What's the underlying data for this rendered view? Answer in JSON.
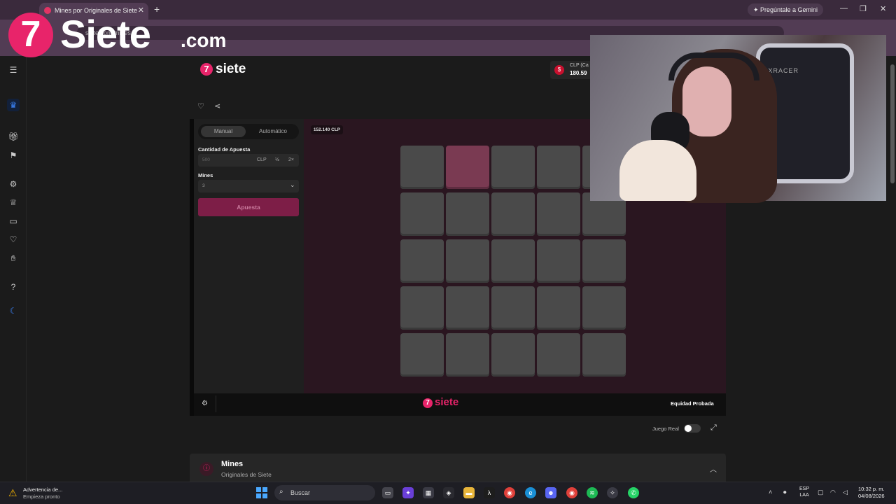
{
  "browser": {
    "tab_title": "Mines por Originales de Siete",
    "tab_close": "✕",
    "new_tab": "+",
    "gemini_button": "✦ Pregúntale a Gemini",
    "url": "siete.com/mines",
    "window_controls": [
      "—",
      "❐",
      "✕"
    ]
  },
  "overlay_logo": {
    "mark": "7",
    "name": "Siete",
    "tld": ".com"
  },
  "site": {
    "logo_mark": "7",
    "logo_text": "siete",
    "balance": {
      "currency_label": "CLP (Ca",
      "amount": "180.59"
    },
    "sidebar_icons": [
      "menu-icon",
      "crown-icon",
      "gift-icon",
      "medal-icon",
      "bike-icon",
      "trophy-icon",
      "video-icon",
      "heart-icon",
      "hand-icon",
      "help-icon",
      "moon-icon"
    ]
  },
  "game": {
    "mode_manual": "Manual",
    "mode_auto": "Automático",
    "bet_label": "Cantidad de Apuesta",
    "bet_placeholder": "500",
    "bet_currency": "CLP",
    "bet_half": "½",
    "bet_double": "2×",
    "mines_label": "Mines",
    "mines_value": "3",
    "bet_button": "Apuesta",
    "win_badge": "152.140 CLP",
    "grid_rows": 5,
    "grid_cols": 5,
    "hovered_tile": [
      0,
      1
    ],
    "footer_logo_mark": "7",
    "footer_logo_text": "siete",
    "fairness": "Equidad Probada"
  },
  "below_game": {
    "real_play_label": "Juego Real",
    "real_play_on": false
  },
  "info_card": {
    "title": "Mines",
    "subtitle": "Originales de Siete"
  },
  "webcam": {
    "chair_text": "DXRACER"
  },
  "taskbar": {
    "warning_title": "Advertencia de...",
    "warning_subtitle": "Empieza pronto",
    "search_placeholder": "Buscar",
    "lang_top": "ESP",
    "lang_bottom": "LAA",
    "time": "10:32 p. m.",
    "date": "04/08/2026"
  },
  "colors": {
    "brand": "#e8246a",
    "bet_button": "#7d1e47",
    "board_bg": "#2a1620",
    "tile": "#4a4a4a"
  }
}
